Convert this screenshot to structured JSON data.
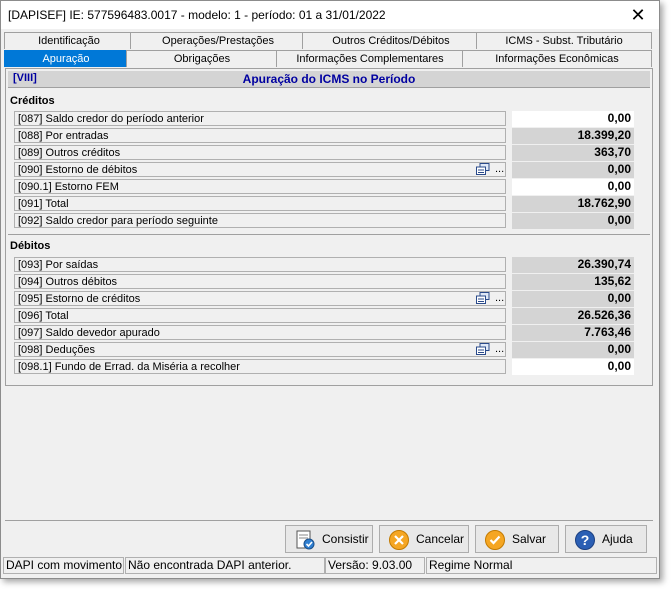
{
  "window": {
    "title": "[DAPISEF] IE: 577596483.0017 -  modelo: 1 -  período: 01 a 31/01/2022"
  },
  "tabs_row1": [
    "Identificação",
    "Operações/Prestações",
    "Outros Créditos/Débitos",
    "ICMS - Subst. Tributário"
  ],
  "tabs_row2": [
    "Apuração",
    "Obrigações",
    "Informações Complementares",
    "Informações Econômicas"
  ],
  "section": {
    "code": "[VIII]",
    "title": "Apuração do ICMS no Período"
  },
  "creditos": {
    "label": "Créditos",
    "rows": [
      {
        "label": "[087] Saldo credor do período anterior",
        "value": "0,00"
      },
      {
        "label": "[088] Por entradas",
        "value": "18.399,20"
      },
      {
        "label": "[089] Outros créditos",
        "value": "363,70"
      },
      {
        "label": "[090] Estorno de débitos",
        "value": "0,00",
        "icon": "edit-list-icon"
      },
      {
        "label": "[090.1] Estorno FEM",
        "value": "0,00"
      },
      {
        "label": "[091] Total",
        "value": "18.762,90"
      },
      {
        "label": "[092] Saldo credor para período seguinte",
        "value": "0,00"
      }
    ]
  },
  "debitos": {
    "label": "Débitos",
    "rows": [
      {
        "label": "[093] Por saídas",
        "value": "26.390,74"
      },
      {
        "label": "[094] Outros débitos",
        "value": "135,62"
      },
      {
        "label": "[095] Estorno de créditos",
        "value": "0,00",
        "icon": "edit-list-icon"
      },
      {
        "label": "[096] Total",
        "value": "26.526,36"
      },
      {
        "label": "[097] Saldo devedor apurado",
        "value": "7.763,46"
      },
      {
        "label": "[098] Deduções",
        "value": "0,00",
        "icon": "edit-list-icon"
      },
      {
        "label": "[098.1] Fundo de Errad. da Miséria a recolher",
        "value": "0,00"
      }
    ]
  },
  "dots": "...",
  "buttons": {
    "consistir": "Consistir",
    "cancelar": "Cancelar",
    "salvar": "Salvar",
    "ajuda": "Ajuda"
  },
  "status": {
    "movimento": "DAPI com movimento",
    "anterior": "Não encontrada DAPI anterior.",
    "versao": "Versão: 9.03.00",
    "regime": "Regime Normal"
  },
  "colors": {
    "accent": "#0078d7",
    "header_text": "#0000a0",
    "value_gray": "#d4d4d4"
  }
}
